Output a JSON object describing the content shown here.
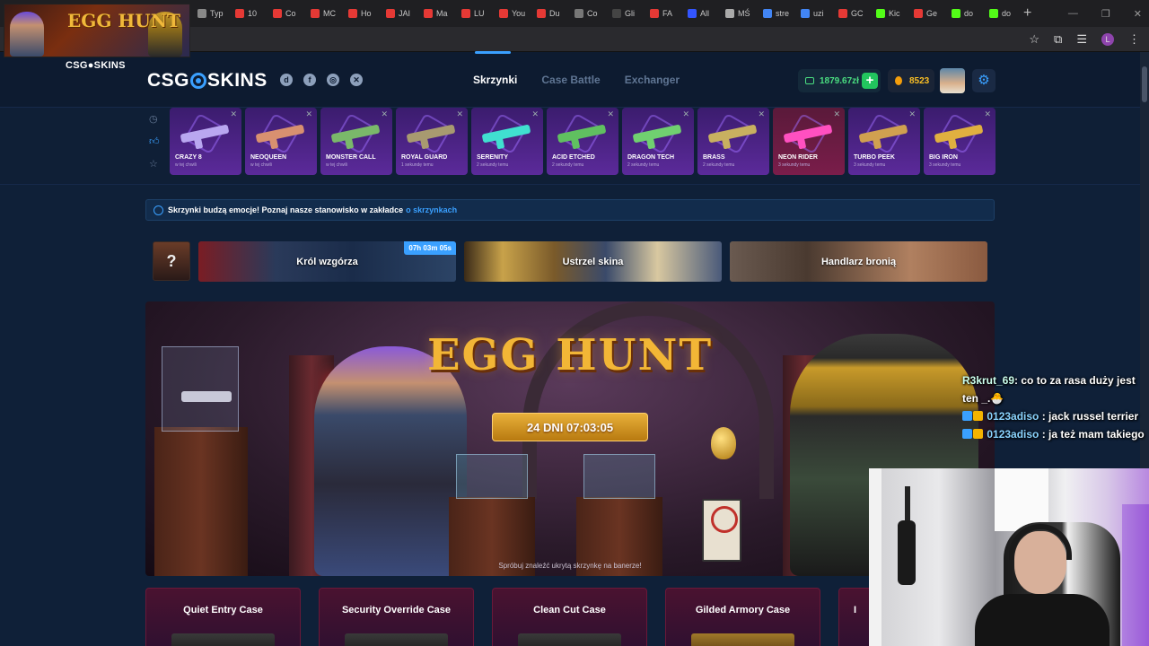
{
  "browser": {
    "tabs": [
      {
        "label": "Typ",
        "color": "#888888"
      },
      {
        "label": "10",
        "color": "#e53935"
      },
      {
        "label": "Co",
        "color": "#e53935"
      },
      {
        "label": "MC",
        "color": "#e53935"
      },
      {
        "label": "Ho",
        "color": "#e53935"
      },
      {
        "label": "JAI",
        "color": "#e53935"
      },
      {
        "label": "Ma",
        "color": "#e53935"
      },
      {
        "label": "LU",
        "color": "#e53935"
      },
      {
        "label": "You",
        "color": "#e53935"
      },
      {
        "label": "Du",
        "color": "#e53935"
      },
      {
        "label": "Co",
        "color": "#777777"
      },
      {
        "label": "Gli",
        "color": "#444444"
      },
      {
        "label": "FA",
        "color": "#e53935"
      },
      {
        "label": "All",
        "color": "#3355ff"
      },
      {
        "label": "MŚ",
        "color": "#aaaaaa"
      },
      {
        "label": "stre",
        "color": "#4285f4"
      },
      {
        "label": "uzi",
        "color": "#4285f4"
      },
      {
        "label": "GC",
        "color": "#e53935"
      },
      {
        "label": "Kic",
        "color": "#53fc18"
      },
      {
        "label": "Ge",
        "color": "#e53935"
      },
      {
        "label": "do",
        "color": "#53fc18"
      },
      {
        "label": "do",
        "color": "#53fc18"
      }
    ],
    "new_tab": "+",
    "profile_initial": "L"
  },
  "overlay": {
    "logo_text": "EGG HUNT",
    "brand": "CSG●SKINS"
  },
  "header": {
    "logo": [
      "CSG",
      "SKINS"
    ],
    "social": [
      "discord-icon",
      "facebook-icon",
      "instagram-icon",
      "x-icon"
    ],
    "nav": [
      "Skrzynki",
      "Case Battle",
      "Exchanger"
    ],
    "balance": "1879.67zł",
    "coins": "8523",
    "accent": "#3aa0ff"
  },
  "drops": [
    {
      "name": "CRAZY 8",
      "time": "w tej chwili",
      "gun_color": "#b9a7f0"
    },
    {
      "name": "NEOQUEEN",
      "time": "w tej chwili",
      "gun_color": "#d89070"
    },
    {
      "name": "MONSTER CALL",
      "time": "w tej chwili",
      "gun_color": "#7ab86a"
    },
    {
      "name": "ROYAL GUARD",
      "time": "1 sekundę temu",
      "gun_color": "#a89a70"
    },
    {
      "name": "SERENITY",
      "time": "2 sekundy temu",
      "gun_color": "#40e0d0"
    },
    {
      "name": "ACID ETCHED",
      "time": "2 sekundy temu",
      "gun_color": "#60c060"
    },
    {
      "name": "DRAGON TECH",
      "time": "2 sekundy temu",
      "gun_color": "#70d070"
    },
    {
      "name": "BRASS",
      "time": "2 sekundy temu",
      "gun_color": "#c8b060"
    },
    {
      "name": "NEON RIDER",
      "time": "3 sekundy temu",
      "gun_color": "#ff50c0"
    },
    {
      "name": "TURBO PEEK",
      "time": "3 sekundy temu",
      "gun_color": "#d0a050"
    },
    {
      "name": "BIG IRON",
      "time": "3 sekundy temu",
      "gun_color": "#e0b040"
    }
  ],
  "info": {
    "text": "Skrzynki budzą emocje! Poznaj nasze stanowisko w zakładce",
    "link": "o skrzynkach"
  },
  "events": {
    "mystery": "?",
    "items": [
      "Król wzgórza",
      "Ustrzel skina",
      "Handlarz bronią"
    ],
    "timer": "07h 03m 05s"
  },
  "banner": {
    "title": "EGG HUNT",
    "countdown": "24 DNI 07:03:05",
    "hint": "Spróbuj znaleźć ukrytą skrzynkę na banerze!"
  },
  "cases": [
    "Quiet Entry Case",
    "Security Override Case",
    "Clean Cut Case",
    "Gilded Armory Case",
    "I"
  ],
  "chat": [
    {
      "user": "R3krut_69",
      "text": ": co to za rasa duży jest ten _.🐣"
    },
    {
      "user": "0123adiso",
      "text": " : jack russel terrier"
    },
    {
      "user": "0123adiso",
      "text": " : ja też mam takiego"
    }
  ]
}
